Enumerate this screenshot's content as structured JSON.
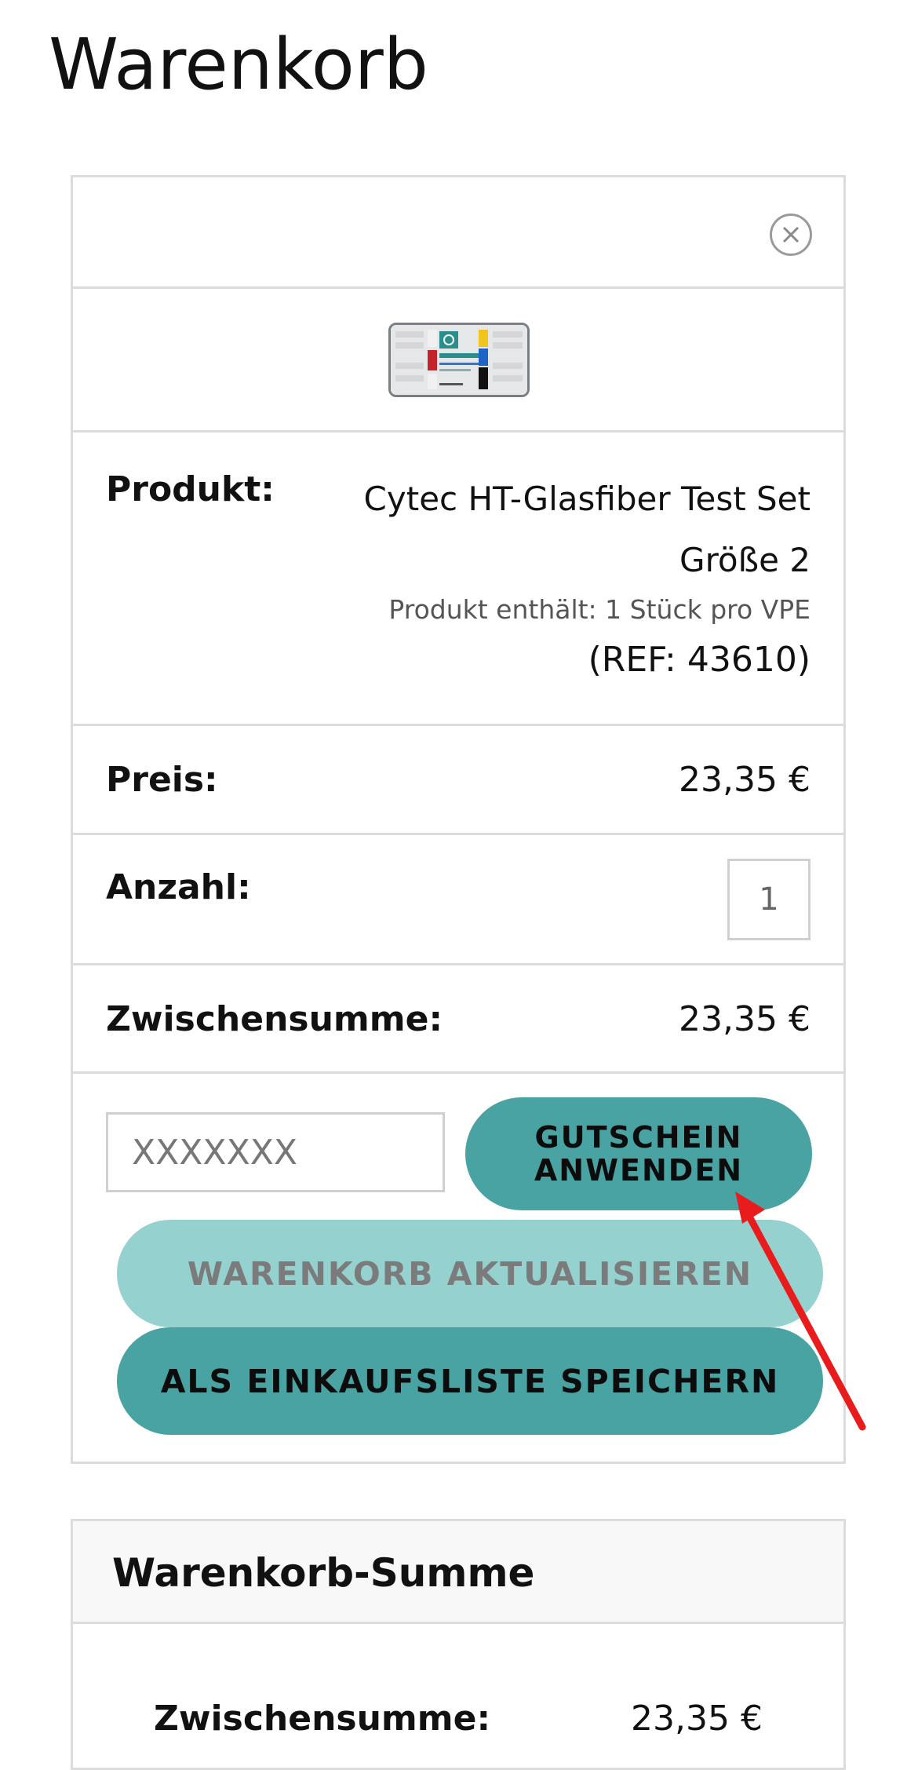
{
  "page": {
    "title": "Warenkorb"
  },
  "cart": {
    "remove_icon": "close-circle-icon",
    "product": {
      "label": "Produkt:",
      "name": "Cytec HT-Glasfiber Test Set Größe 2",
      "pack_info": "Produkt enthält: 1 Stück pro VPE",
      "ref": "(REF: 43610)",
      "image_alt": "Cytec HT-Glasfiber Test Set"
    },
    "price": {
      "label": "Preis:",
      "value": "23,35 €"
    },
    "quantity": {
      "label": "Anzahl:",
      "value": "1"
    },
    "subtotal": {
      "label": "Zwischensumme:",
      "value": "23,35 €"
    },
    "coupon": {
      "placeholder": "XXXXXXX",
      "button_label": "GUTSCHEIN ANWENDEN"
    },
    "update_button_label": "WARENKORB AKTUALISIEREN",
    "save_list_button_label": "ALS EINKAUFSLISTE SPEICHERN"
  },
  "totals": {
    "title": "Warenkorb-Summe",
    "subtotal_label": "Zwischensumme:",
    "subtotal_value": "23,35 €"
  },
  "colors": {
    "accent": "#49a3a2",
    "accent_light": "#95d1cf",
    "annotation_arrow": "#e81c1c"
  }
}
